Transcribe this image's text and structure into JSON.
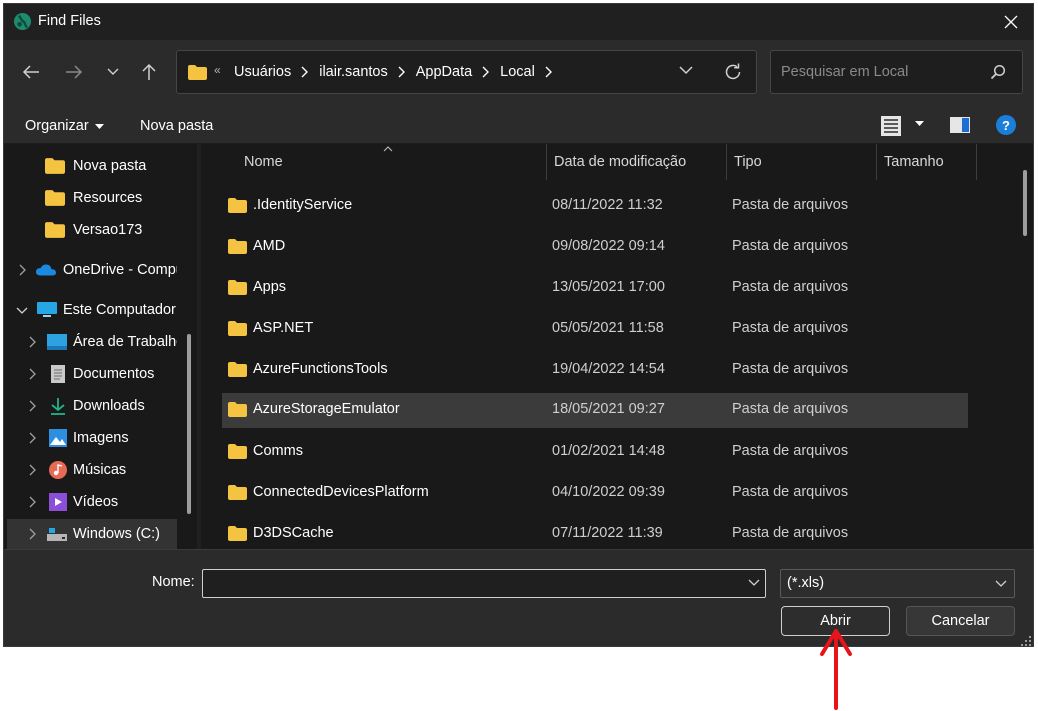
{
  "window": {
    "title": "Find Files"
  },
  "address": {
    "more": "«",
    "crumbs": [
      "Usuários",
      "ilair.santos",
      "AppData",
      "Local"
    ]
  },
  "search": {
    "placeholder": "Pesquisar em Local"
  },
  "toolbar": {
    "organize_label": "Organizar",
    "new_folder_label": "Nova pasta",
    "help_label": "?"
  },
  "sidebar": {
    "items": [
      {
        "label": "Nova pasta",
        "icon": "folder-icon"
      },
      {
        "label": "Resources",
        "icon": "folder-icon"
      },
      {
        "label": "Versao173",
        "icon": "folder-icon"
      },
      {
        "label": "OneDrive - Compu",
        "icon": "onedrive-icon"
      },
      {
        "label": "Este Computador",
        "icon": "computer-icon"
      },
      {
        "label": "Área de Trabalho",
        "icon": "desktop-icon"
      },
      {
        "label": "Documentos",
        "icon": "documents-icon"
      },
      {
        "label": "Downloads",
        "icon": "downloads-icon"
      },
      {
        "label": "Imagens",
        "icon": "pictures-icon"
      },
      {
        "label": "Músicas",
        "icon": "music-icon"
      },
      {
        "label": "Vídeos",
        "icon": "videos-icon"
      },
      {
        "label": "Windows (C:)",
        "icon": "drive-icon"
      }
    ]
  },
  "files": {
    "columns": {
      "name": "Nome",
      "date": "Data de modificação",
      "type": "Tipo",
      "size": "Tamanho"
    },
    "rows": [
      {
        "name": ".IdentityService",
        "date": "08/11/2022 11:32",
        "type": "Pasta de arquivos"
      },
      {
        "name": "AMD",
        "date": "09/08/2022 09:14",
        "type": "Pasta de arquivos"
      },
      {
        "name": "Apps",
        "date": "13/05/2021 17:00",
        "type": "Pasta de arquivos"
      },
      {
        "name": "ASP.NET",
        "date": "05/05/2021 11:58",
        "type": "Pasta de arquivos"
      },
      {
        "name": "AzureFunctionsTools",
        "date": "19/04/2022 14:54",
        "type": "Pasta de arquivos"
      },
      {
        "name": "AzureStorageEmulator",
        "date": "18/05/2021 09:27",
        "type": "Pasta de arquivos"
      },
      {
        "name": "Comms",
        "date": "01/02/2021 14:48",
        "type": "Pasta de arquivos"
      },
      {
        "name": "ConnectedDevicesPlatform",
        "date": "04/10/2022 09:39",
        "type": "Pasta de arquivos"
      },
      {
        "name": "D3DSCache",
        "date": "07/11/2022 11:39",
        "type": "Pasta de arquivos"
      }
    ]
  },
  "bottom": {
    "name_label": "Nome:",
    "name_value": "",
    "filter_value": "(*.xls)",
    "open_label": "Abrir",
    "cancel_label": "Cancelar"
  },
  "colors": {
    "background": "#202020",
    "accent": "#1b7fd9",
    "folder": "#f5c342",
    "annotation": "#e8141a"
  }
}
